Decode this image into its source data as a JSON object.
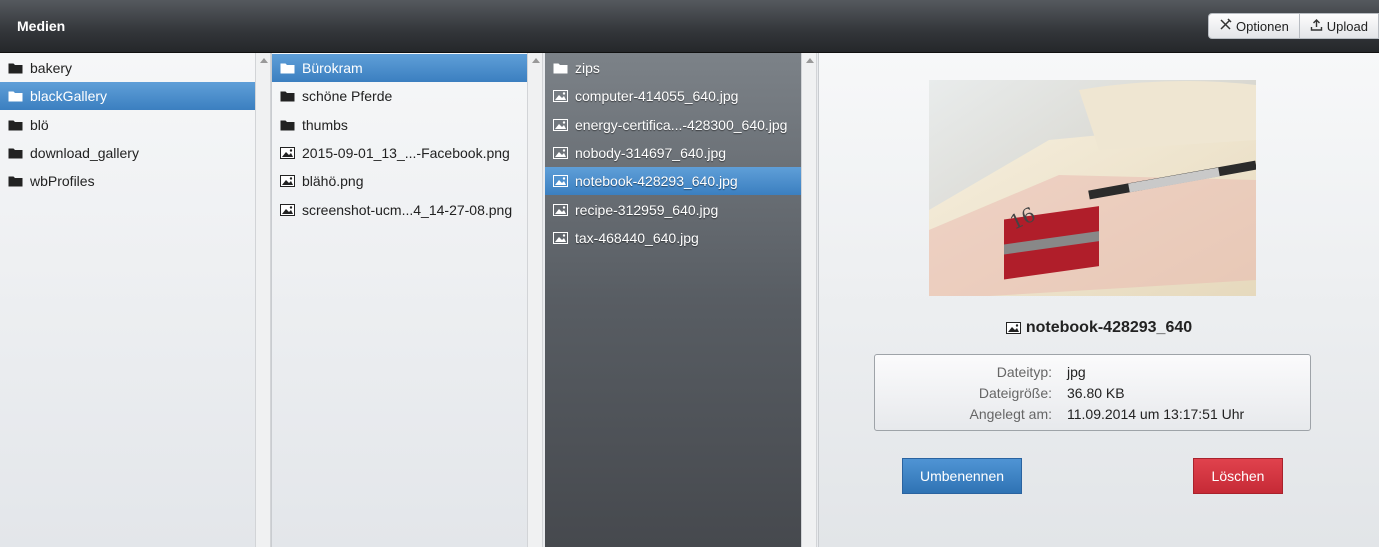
{
  "app": {
    "title": "Medien"
  },
  "toolbar": {
    "options_label": "Optionen",
    "upload_label": "Upload"
  },
  "column1": {
    "items": [
      {
        "label": "bakery",
        "type": "folder",
        "selected": false
      },
      {
        "label": "blackGallery",
        "type": "folder",
        "selected": true
      },
      {
        "label": "blö",
        "type": "folder",
        "selected": false
      },
      {
        "label": "download_gallery",
        "type": "folder",
        "selected": false
      },
      {
        "label": "wbProfiles",
        "type": "folder",
        "selected": false
      }
    ]
  },
  "column2": {
    "items": [
      {
        "label": "Bürokram",
        "type": "folder",
        "selected": true
      },
      {
        "label": "schöne Pferde",
        "type": "folder",
        "selected": false
      },
      {
        "label": "thumbs",
        "type": "folder",
        "selected": false
      },
      {
        "label": "2015-09-01_13_...-Facebook.png",
        "type": "image",
        "selected": false
      },
      {
        "label": "blähö.png",
        "type": "image",
        "selected": false
      },
      {
        "label": "screenshot-ucm...4_14-27-08.png",
        "type": "image",
        "selected": false
      }
    ]
  },
  "column3": {
    "items": [
      {
        "label": "zips",
        "type": "folder",
        "selected": false
      },
      {
        "label": "computer-414055_640.jpg",
        "type": "image",
        "selected": false
      },
      {
        "label": "energy-certifica...-428300_640.jpg",
        "type": "image",
        "selected": false
      },
      {
        "label": "nobody-314697_640.jpg",
        "type": "image",
        "selected": false
      },
      {
        "label": "notebook-428293_640.jpg",
        "type": "image",
        "selected": true
      },
      {
        "label": "recipe-312959_640.jpg",
        "type": "image",
        "selected": false
      },
      {
        "label": "tax-468440_640.jpg",
        "type": "image",
        "selected": false
      }
    ]
  },
  "preview": {
    "filename": "notebook-428293_640",
    "info": [
      {
        "key": "Dateityp:",
        "value": "jpg"
      },
      {
        "key": "Dateigröße:",
        "value": "36.80 KB"
      },
      {
        "key": "Angelegt am:",
        "value": "11.09.2014 um 13:17:51 Uhr"
      }
    ],
    "rename_label": "Umbenennen",
    "delete_label": "Löschen"
  },
  "colors": {
    "selection": "#3b7fc0",
    "rename": "#2f73b4",
    "delete": "#c62a36"
  }
}
